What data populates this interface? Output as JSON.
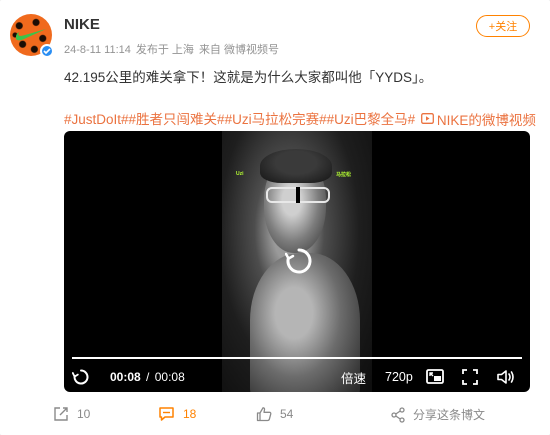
{
  "post": {
    "username": "NIKE",
    "date": "24-8-11 11:14",
    "posted_from": "发布于 上海",
    "source": "来自 微博视频号",
    "follow_label": "+关注",
    "text": "42.195公里的难关拿下！这就是为什么大家都叫他「YYDS」。",
    "topics": [
      "#JustDoIt#",
      "#胜者只闯难关#",
      "#Uzi马拉松完赛#",
      "#Uzi巴黎全马#"
    ],
    "video_link_label": "NIKE的微博视频"
  },
  "video": {
    "current_time": "00:08",
    "separator": "/",
    "duration": "00:08",
    "speed_label": "倍速",
    "quality_label": "720p",
    "progress": 1.0,
    "frame_text_left": "Uzi",
    "frame_text_right": "马拉松"
  },
  "footer": {
    "share_count": "10",
    "comment_count": "18",
    "like_count": "54",
    "share_to_weibo_label": "分享这条博文"
  },
  "colors": {
    "accent_orange": "#ff8200",
    "topic_color": "#eb7340",
    "verified_blue": "#2a8ef3"
  }
}
